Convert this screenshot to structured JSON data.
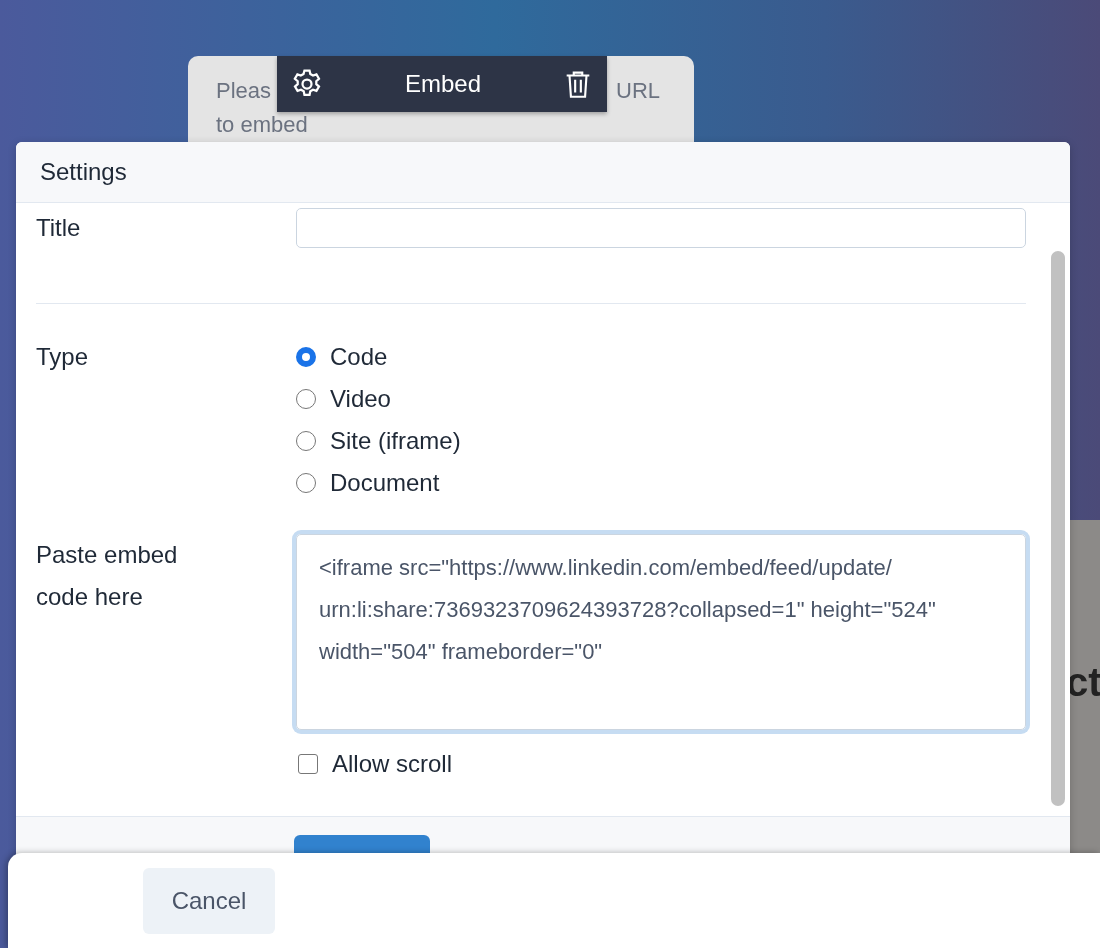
{
  "placeholder_card": {
    "fragments": [
      "Pleas",
      "URL"
    ],
    "line_2": "to embed"
  },
  "toolbar": {
    "title": "Embed"
  },
  "background_heading": "ct",
  "settings": {
    "title": "Settings",
    "title_field": {
      "label": "Title"
    },
    "type": {
      "label": "Type",
      "options": [
        {
          "label": "Code",
          "selected": true
        },
        {
          "label": "Video",
          "selected": false
        },
        {
          "label": "Site (iframe)",
          "selected": false
        },
        {
          "label": "Document",
          "selected": false
        }
      ]
    },
    "embed_code": {
      "label": "Paste embed code here",
      "value": "<iframe src=\"https://www.linkedin.com/embed/feed/update/urn:li:share:7369323709624393728?collapsed=1\" height=\"524\" width=\"504\" frameborder=\"0\""
    },
    "allow_scroll": {
      "label": "Allow scroll",
      "checked": false
    }
  },
  "bottom_bar": {
    "cancel": "Cancel"
  }
}
